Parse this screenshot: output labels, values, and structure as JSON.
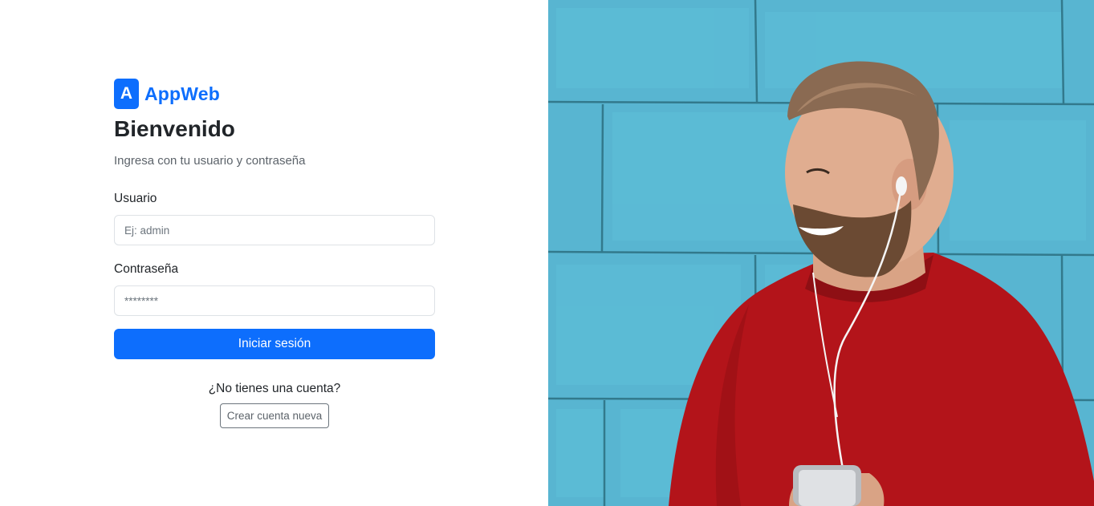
{
  "brand": {
    "logo_letter": "A",
    "name": "AppWeb",
    "color": "#0d6efd"
  },
  "login": {
    "title": "Bienvenido",
    "subtitle": "Ingresa con tu usuario y contraseña",
    "username": {
      "label": "Usuario",
      "placeholder": "Ej: admin",
      "value": ""
    },
    "password": {
      "label": "Contraseña",
      "placeholder": "********",
      "value": ""
    },
    "submit_label": "Iniciar sesión"
  },
  "signup": {
    "prompt": "¿No tienes una cuenta?",
    "button_label": "Crear cuenta nueva"
  },
  "hero": {
    "image": "smiling-man-with-earphones-and-phone-photo"
  }
}
